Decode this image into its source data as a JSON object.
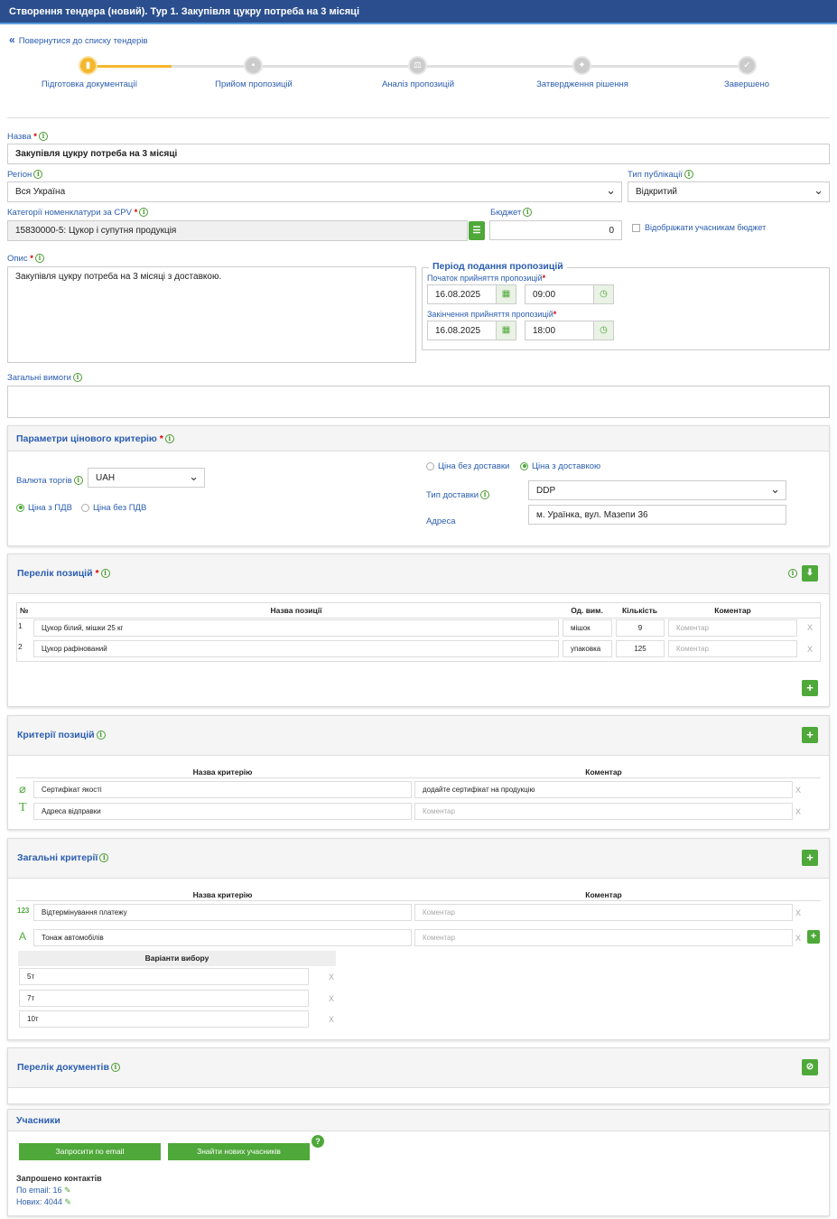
{
  "header": {
    "title": "Створення тендера (новий). Тур 1. Закупівля цукру потреба на 3 місяці"
  },
  "back_link": "Повернутися до списку тендерів",
  "steps": [
    "Підготовка документації",
    "Прийом пропозицій",
    "Аналіз пропозицій",
    "Затвердження рішення",
    "Завершено"
  ],
  "form": {
    "name_label": "Назва",
    "name_value": "Закупівля цукру потреба на 3 місяці",
    "region_label": "Регіон",
    "region_value": "Вся Україна",
    "pubtype_label": "Тип публікації",
    "pubtype_value": "Відкритий",
    "cpv_label": "Категорії номенклатури за CPV",
    "cpv_value": "15830000-5: Цукор і супутня продукція",
    "budget_label": "Бюджет",
    "budget_value": "0",
    "show_budget": "Відображати учасникам бюджет",
    "desc_label": "Опис",
    "desc_value": "Закупівля цукру потреба на 3 місяці з доставкою.",
    "period_title": "Період подання пропозицій",
    "start_label": "Початок прийняття пропозицій",
    "start_date": "16.08.2025",
    "start_time": "09:00",
    "end_label": "Закінчення прийняття пропозицій",
    "end_date": "16.08.2025",
    "end_time": "18:00",
    "general_req_label": "Загальні вимоги"
  },
  "price": {
    "title": "Параметри цінового критерію",
    "currency_label": "Валюта торгів",
    "currency": "UAH",
    "vat_on": "Ціна з ПДВ",
    "vat_off": "Ціна без ПДВ",
    "no_delivery": "Ціна без доставки",
    "with_delivery": "Ціна з доставкою",
    "delivery_type_label": "Тип доставки",
    "delivery_type": "DDP",
    "address_label": "Адреса",
    "address": "м. Ураїнка, вул. Мазепи 36"
  },
  "positions": {
    "title": "Перелік позицій",
    "headers": [
      "№",
      "Назва позиції",
      "Од. вим.",
      "Кількість",
      "Коментар"
    ],
    "rows": [
      {
        "n": "1",
        "name": "Цукор білий, мішки 25 кг",
        "unit": "мішок",
        "qty": "9",
        "comment": "Коментар"
      },
      {
        "n": "2",
        "name": "Цукор рафінований",
        "unit": "упаковка",
        "qty": "125",
        "comment": "Коментар"
      }
    ]
  },
  "pos_criteria": {
    "title": "Критерії позицій",
    "headers": [
      "Назва критерію",
      "Коментар"
    ],
    "rows": [
      {
        "name": "Сертифікат якості",
        "comment": "додайте сертифікат на продукцію"
      },
      {
        "name": "Адреса відправки",
        "comment": "Коментар"
      }
    ]
  },
  "gen_criteria": {
    "title": "Загальні критерії",
    "headers": [
      "Назва критерію",
      "Коментар"
    ],
    "rows": [
      {
        "icon": "123",
        "name": "Відтермінування платежу",
        "comment": "Коментар"
      },
      {
        "name": "Тонаж автомобілів",
        "comment": "Коментар"
      }
    ],
    "variants_title": "Варіанти вибору",
    "variants": [
      "5т",
      "7т",
      "10т"
    ]
  },
  "documents": {
    "title": "Перелік документів"
  },
  "participants": {
    "title": "Учасники",
    "invite_btn": "Запросити по email",
    "find_btn": "Знайти нових учасників",
    "invited_title": "Запрошено контактів",
    "by_email": "По email: 16",
    "new_count": "Нових: 4044"
  },
  "x": "X",
  "plus": "+",
  "question": "?"
}
